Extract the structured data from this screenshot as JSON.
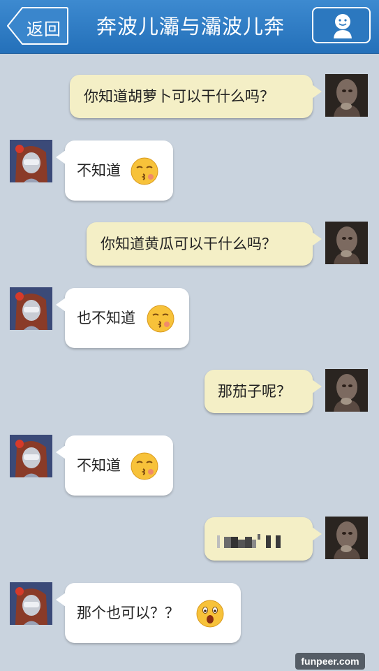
{
  "header": {
    "back_label": "返回",
    "title": "奔波儿灞与灞波儿奔",
    "profile_icon": "user-avatar-icon"
  },
  "messages": [
    {
      "side": "out",
      "text": "你知道胡萝卜可以干什么吗？"
    },
    {
      "side": "in",
      "text": "不知道",
      "emoji": "kissing-face-emoji"
    },
    {
      "side": "out",
      "text": "你知道黄瓜可以干什么吗？"
    },
    {
      "side": "in",
      "text": "也不知道",
      "emoji": "kissing-face-emoji"
    },
    {
      "side": "out",
      "text": "那茄子呢？"
    },
    {
      "side": "in",
      "text": "不知道",
      "emoji": "kissing-face-emoji"
    },
    {
      "side": "out",
      "text": "",
      "note": "pixelated",
      "pixelated": true
    },
    {
      "side": "in",
      "text": "那个也可以？？",
      "emoji": "astonished-face-emoji"
    }
  ],
  "watermark": "funpeer.com",
  "colors": {
    "header": "#2f7cc4",
    "background": "#c9d3de",
    "outgoing_bubble": "#f4efc6",
    "incoming_bubble": "#ffffff"
  }
}
